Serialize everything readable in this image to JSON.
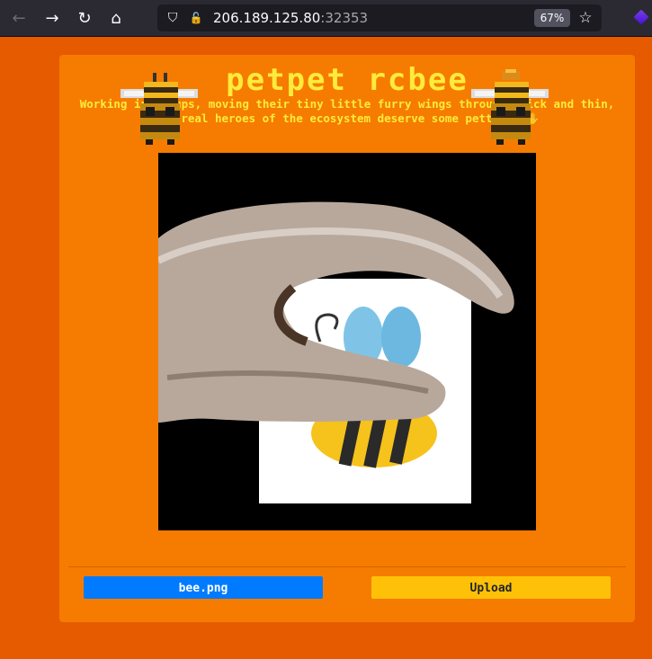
{
  "browser": {
    "back_icon": "←",
    "forward_icon": "→",
    "reload_icon": "↻",
    "home_icon": "⌂",
    "shield_icon": "⛉",
    "lock_icon": "🔓",
    "url_host": "206.189.125.80",
    "url_port": ":32353",
    "zoom": "67%",
    "star_icon": "☆"
  },
  "page": {
    "title": "petpet rcbee",
    "subtitle": "Working in groups, moving their tiny little furry wings through thick and thin, the real heroes of the ecosystem deserve some petting! ✋",
    "file_button_label": "bee.png",
    "upload_button_label": "Upload"
  },
  "colors": {
    "page_bg": "#e65a00",
    "card_bg": "#f57c00",
    "title_color": "#ffeb3b",
    "file_button": "#007bff",
    "upload_button": "#ffc107"
  }
}
